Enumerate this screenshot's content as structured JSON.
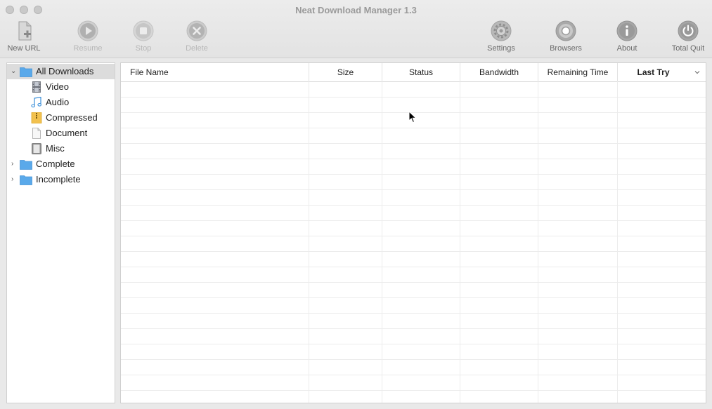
{
  "window": {
    "title": "Neat Download Manager 1.3"
  },
  "toolbar": {
    "new_url": "New URL",
    "resume": "Resume",
    "stop": "Stop",
    "delete": "Delete",
    "settings": "Settings",
    "browsers": "Browsers",
    "about": "About",
    "total_quit": "Total Quit"
  },
  "sidebar": {
    "items": [
      {
        "label": "All Downloads",
        "icon": "folder-icon"
      },
      {
        "label": "Video",
        "icon": "film-icon"
      },
      {
        "label": "Audio",
        "icon": "music-note-icon"
      },
      {
        "label": "Compressed",
        "icon": "zip-icon"
      },
      {
        "label": "Document",
        "icon": "document-icon"
      },
      {
        "label": "Misc",
        "icon": "misc-icon"
      },
      {
        "label": "Complete",
        "icon": "folder-icon"
      },
      {
        "label": "Incomplete",
        "icon": "folder-icon"
      }
    ]
  },
  "table": {
    "columns": [
      "File Name",
      "Size",
      "Status",
      "Bandwidth",
      "Remaining Time",
      "Last Try"
    ],
    "sorted_column": "Last Try",
    "rows": []
  },
  "colors": {
    "folder": "#5aa9ea",
    "selection": "#dcdcdc",
    "zip": "#f2c14e"
  }
}
